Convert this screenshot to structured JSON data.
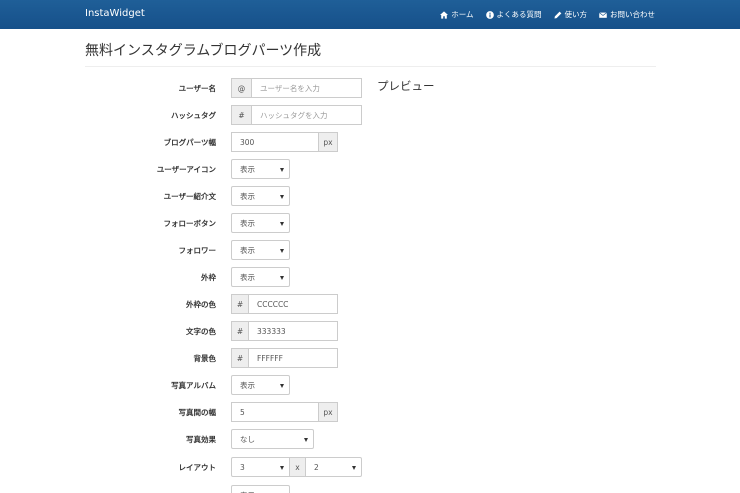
{
  "navbar": {
    "brand": "InstaWidget",
    "links": [
      {
        "label": "ホーム",
        "icon": "home-icon"
      },
      {
        "label": "よくある質問",
        "icon": "info-icon"
      },
      {
        "label": "使い方",
        "icon": "pencil-icon"
      },
      {
        "label": "お問い合わせ",
        "icon": "envelope-icon"
      }
    ]
  },
  "page": {
    "title": "無料インスタグラムブログパーツ作成"
  },
  "preview": {
    "heading": "プレビュー"
  },
  "form": {
    "username": {
      "label": "ユーザー名",
      "addon": "@",
      "placeholder": "ユーザー名を入力"
    },
    "hashtag": {
      "label": "ハッシュタグ",
      "addon": "#",
      "placeholder": "ハッシュタグを入力"
    },
    "width": {
      "label": "ブログパーツ幅",
      "value": "300",
      "unit": "px"
    },
    "user_icon": {
      "label": "ユーザーアイコン",
      "selected": "表示"
    },
    "user_bio": {
      "label": "ユーザー紹介文",
      "selected": "表示"
    },
    "follow_button": {
      "label": "フォローボタン",
      "selected": "表示"
    },
    "followers": {
      "label": "フォロワー",
      "selected": "表示"
    },
    "border": {
      "label": "外枠",
      "selected": "表示"
    },
    "border_color": {
      "label": "外枠の色",
      "addon": "#",
      "value": "CCCCCC"
    },
    "text_color": {
      "label": "文字の色",
      "addon": "#",
      "value": "333333"
    },
    "bg_color": {
      "label": "背景色",
      "addon": "#",
      "value": "FFFFFF"
    },
    "album": {
      "label": "写真アルバム",
      "selected": "表示"
    },
    "photo_gap": {
      "label": "写真間の幅",
      "value": "5",
      "unit": "px"
    },
    "photo_effect": {
      "label": "写真効果",
      "selected": "なし"
    },
    "layout": {
      "label": "レイアウト",
      "cols": "3",
      "separator": "x",
      "rows": "2"
    },
    "last_select": {
      "selected": "表示"
    }
  }
}
